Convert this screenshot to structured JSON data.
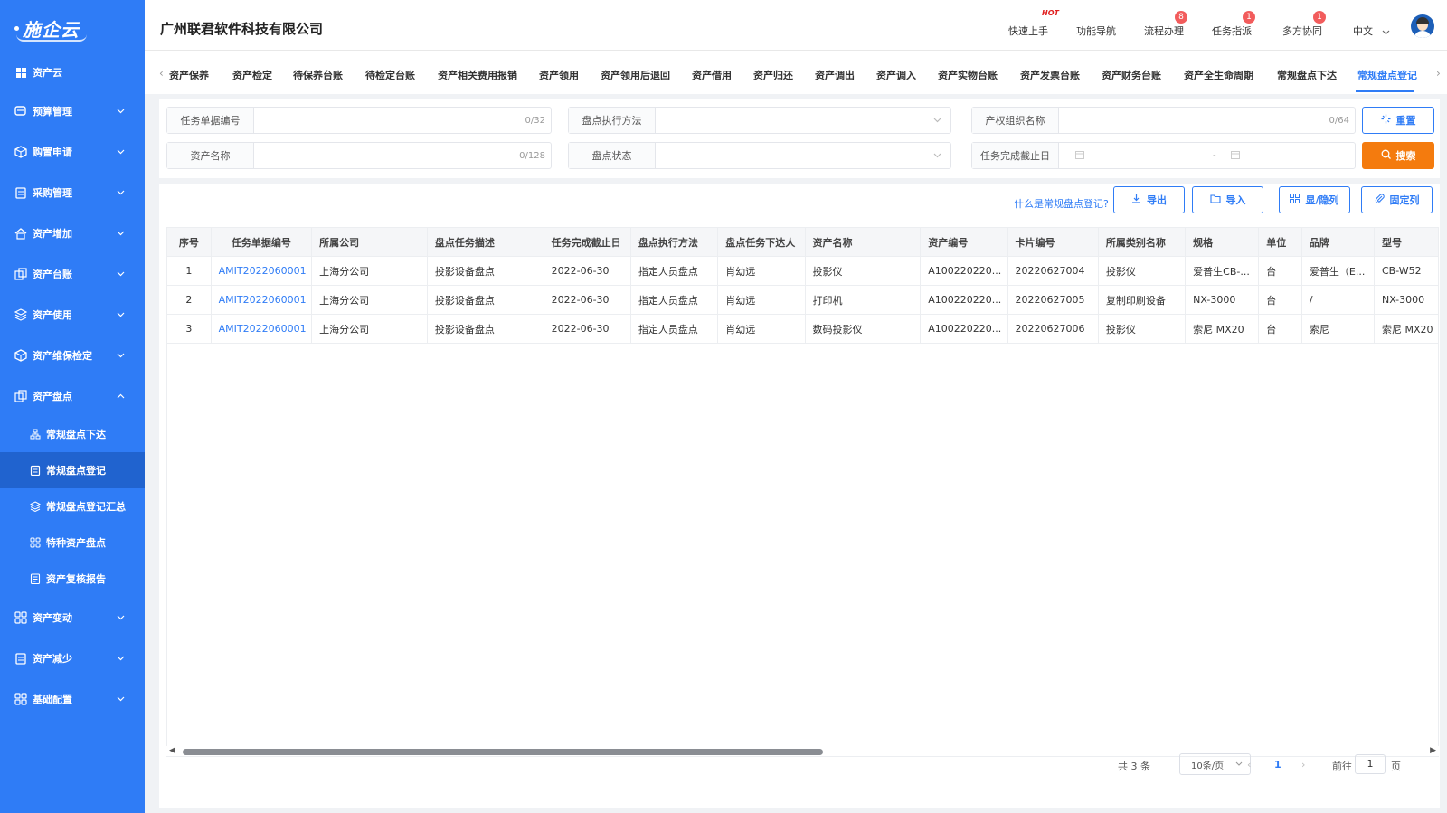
{
  "sidebar": {
    "logo": "施企云",
    "items": [
      {
        "label": "资产云",
        "icon": "grid-icon"
      },
      {
        "label": "预算管理",
        "icon": "budget-icon"
      },
      {
        "label": "购置申请",
        "icon": "cube-icon"
      },
      {
        "label": "采购管理",
        "icon": "clipboard-icon"
      },
      {
        "label": "资产增加",
        "icon": "home-icon"
      },
      {
        "label": "资产台账",
        "icon": "ledger-icon"
      },
      {
        "label": "资产使用",
        "icon": "layers-icon"
      },
      {
        "label": "资产维保检定",
        "icon": "cube-icon"
      },
      {
        "label": "资产盘点",
        "icon": "ledger-icon"
      },
      {
        "label": "资产变动",
        "icon": "apps-icon"
      },
      {
        "label": "资产减少",
        "icon": "clipboard-icon"
      },
      {
        "label": "基础配置",
        "icon": "apps-icon"
      }
    ],
    "sub_items": [
      {
        "label": "常规盘点下达",
        "icon": "org-icon"
      },
      {
        "label": "常规盘点登记",
        "icon": "clipboard-icon"
      },
      {
        "label": "常规盘点登记汇总",
        "icon": "layers-icon"
      },
      {
        "label": "特种资产盘点",
        "icon": "apps-icon"
      },
      {
        "label": "资产复核报告",
        "icon": "report-icon"
      }
    ]
  },
  "header": {
    "company": "广州联君软件科技有限公司",
    "quick_start": "快速上手",
    "hot": "HOT",
    "nav_guide": "功能导航",
    "flow": "流程办理",
    "flow_badge": "8",
    "task": "任务指派",
    "task_badge": "1",
    "collab": "多方协同",
    "collab_badge": "1",
    "lang": "中文"
  },
  "tabs": [
    "资产保养",
    "资产检定",
    "待保养台账",
    "待检定台账",
    "资产相关费用报销",
    "资产领用",
    "资产领用后退回",
    "资产借用",
    "资产归还",
    "资产调出",
    "资产调入",
    "资产实物台账",
    "资产发票台账",
    "资产财务台账",
    "资产全生命周期",
    "常规盘点下达",
    "常规盘点登记"
  ],
  "filters": {
    "task_no": {
      "label": "任务单据编号",
      "count": "0/32"
    },
    "method": {
      "label": "盘点执行方法"
    },
    "org": {
      "label": "产权组织名称",
      "count": "0/64"
    },
    "asset_name": {
      "label": "资产名称",
      "count": "0/128"
    },
    "status": {
      "label": "盘点状态"
    },
    "deadline": {
      "label": "任务完成截止日",
      "sep": "-"
    },
    "reset": "重置",
    "search": "搜索"
  },
  "toolbar": {
    "help": "什么是常规盘点登记?",
    "export": "导出",
    "import": "导入",
    "show_hide": "显/隐列",
    "fixed": "固定列"
  },
  "table": {
    "columns": [
      "序号",
      "任务单据编号",
      "所属公司",
      "盘点任务描述",
      "任务完成截止日",
      "盘点执行方法",
      "盘点任务下达人",
      "资产名称",
      "资产编号",
      "卡片编号",
      "所属类别名称",
      "规格",
      "单位",
      "品牌",
      "型号"
    ],
    "rows": [
      [
        "1",
        "AMIT2022060001",
        "上海分公司",
        "投影设备盘点",
        "2022-06-30",
        "指定人员盘点",
        "肖幼远",
        "投影仪",
        "A100220220...",
        "20220627004",
        "投影仪",
        "爱普生CB-...",
        "台",
        "爱普生（E...",
        "CB-W52"
      ],
      [
        "2",
        "AMIT2022060001",
        "上海分公司",
        "投影设备盘点",
        "2022-06-30",
        "指定人员盘点",
        "肖幼远",
        "打印机",
        "A100220220...",
        "20220627005",
        "复制印刷设备",
        "NX-3000",
        "台",
        "/",
        "NX-3000"
      ],
      [
        "3",
        "AMIT2022060001",
        "上海分公司",
        "投影设备盘点",
        "2022-06-30",
        "指定人员盘点",
        "肖幼远",
        "数码投影仪",
        "A100220220...",
        "20220627006",
        "投影仪",
        "索尼 MX20",
        "台",
        "索尼",
        "索尼 MX20"
      ]
    ]
  },
  "pagination": {
    "total": "共 3 条",
    "page_size": "10条/页",
    "current": "1",
    "goto": "前往",
    "goto_value": "1",
    "page_unit": "页"
  },
  "colors": {
    "primary": "#2f7cf6",
    "sidebar_active": "#2063cf",
    "search": "#f47b0e",
    "badge": "#f25c5c"
  }
}
